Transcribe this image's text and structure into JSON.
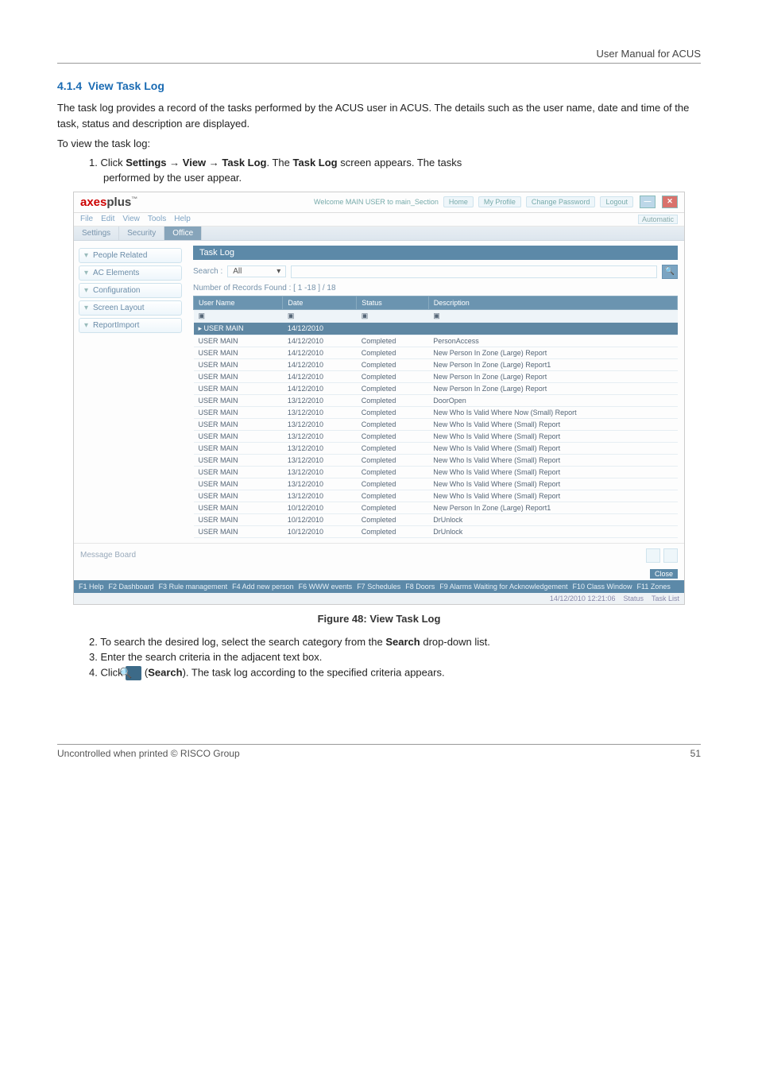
{
  "doc": {
    "header_right": "User Manual for ACUS",
    "section_num": "4.1.4",
    "section_title": "View Task Log",
    "para1": "The task log provides a record of the tasks performed by the ACUS user in ACUS. The details such as the user name, date and time of the task, status and description are displayed.",
    "para2": "To view the task log:",
    "step1_pre": "1.   Click ",
    "step1_b1": "Settings",
    "step1_arrow": " → ",
    "step1_b2": "View",
    "step1_b3": "Task Log",
    "step1_mid": ". The ",
    "step1_b4": "Task Log",
    "step1_end": " screen appears. The tasks",
    "step1_line2": "performed by the user appear.",
    "figure_caption": "Figure 48: View Task Log",
    "step2_pre": "2.   To search the desired log, select the search category from the ",
    "step2_b": "Search",
    "step2_end": " drop-down list.",
    "step3": "3.   Enter the search criteria in the adjacent text box.",
    "step4_pre": "4.   Click ",
    "step4_b": "Search",
    "step4_end": "). The task log according to the specified criteria appears.",
    "footer_left": "Uncontrolled when printed © RISCO Group",
    "footer_right": "51"
  },
  "app": {
    "brand_axes": "axes",
    "brand_plus": "plus",
    "welcome": "Welcome MAIN USER to main_Section",
    "home": "Home",
    "my_profile": "My Profile",
    "change_pw": "Change Password",
    "logout": "Logout",
    "menu": [
      "File",
      "Edit",
      "View",
      "Tools",
      "Help"
    ],
    "automatic": "Automatic",
    "tabs": [
      "Settings",
      "Security",
      "Office"
    ],
    "accordion": [
      "People Related",
      "AC Elements",
      "Configuration",
      "Screen Layout",
      "ReportImport"
    ],
    "panel_title": "Task Log",
    "search_label": "Search :",
    "search_value": "All",
    "record_count": "Number of Records Found : [ 1 -18 ] / 18",
    "columns": [
      "User Name",
      "Date",
      "Status",
      "Description"
    ],
    "filter_glyph": "▣",
    "rows": [
      {
        "u": "USER MAIN",
        "d": "14/12/2010",
        "s": "Completed",
        "desc": "PersonAccess"
      },
      {
        "u": "USER MAIN",
        "d": "14/12/2010",
        "s": "Completed",
        "desc": "New Person In Zone (Large) Report"
      },
      {
        "u": "USER MAIN",
        "d": "14/12/2010",
        "s": "Completed",
        "desc": "New Person In Zone (Large) Report1"
      },
      {
        "u": "USER MAIN",
        "d": "14/12/2010",
        "s": "Completed",
        "desc": "New Person In Zone (Large) Report"
      },
      {
        "u": "USER MAIN",
        "d": "14/12/2010",
        "s": "Completed",
        "desc": "New Person In Zone (Large) Report"
      },
      {
        "u": "USER MAIN",
        "d": "13/12/2010",
        "s": "Completed",
        "desc": "DoorOpen"
      },
      {
        "u": "USER MAIN",
        "d": "13/12/2010",
        "s": "Completed",
        "desc": "New Who Is Valid Where Now (Small) Report"
      },
      {
        "u": "USER MAIN",
        "d": "13/12/2010",
        "s": "Completed",
        "desc": "New Who Is Valid Where (Small) Report"
      },
      {
        "u": "USER MAIN",
        "d": "13/12/2010",
        "s": "Completed",
        "desc": "New Who Is Valid Where (Small) Report"
      },
      {
        "u": "USER MAIN",
        "d": "13/12/2010",
        "s": "Completed",
        "desc": "New Who Is Valid Where (Small) Report"
      },
      {
        "u": "USER MAIN",
        "d": "13/12/2010",
        "s": "Completed",
        "desc": "New Who Is Valid Where (Small) Report"
      },
      {
        "u": "USER MAIN",
        "d": "13/12/2010",
        "s": "Completed",
        "desc": "New Who Is Valid Where (Small) Report"
      },
      {
        "u": "USER MAIN",
        "d": "13/12/2010",
        "s": "Completed",
        "desc": "New Who Is Valid Where (Small) Report"
      },
      {
        "u": "USER MAIN",
        "d": "13/12/2010",
        "s": "Completed",
        "desc": "New Who Is Valid Where (Small) Report"
      },
      {
        "u": "USER MAIN",
        "d": "10/12/2010",
        "s": "Completed",
        "desc": "New Person In Zone (Large) Report1"
      },
      {
        "u": "USER MAIN",
        "d": "10/12/2010",
        "s": "Completed",
        "desc": "DrUnlock"
      },
      {
        "u": "USER MAIN",
        "d": "10/12/2010",
        "s": "Completed",
        "desc": "DrUnlock"
      }
    ],
    "selected_row_user": "USER MAIN",
    "selected_row_date": "14/12/2010",
    "message_board": "Message Board",
    "close_btn": "Close",
    "fkeys": [
      "F1 Help",
      "F2 Dashboard",
      "F3 Rule management",
      "F4 Add new person",
      "F6 WWW events",
      "F7 Schedules",
      "F8 Doors",
      "F9 Alarms Waiting for Acknowledgement",
      "F10 Class Window",
      "F11 Zones"
    ],
    "status_time": "14/12/2010  12:21:06",
    "status_lbl": "Status",
    "status_task": "Task List"
  }
}
